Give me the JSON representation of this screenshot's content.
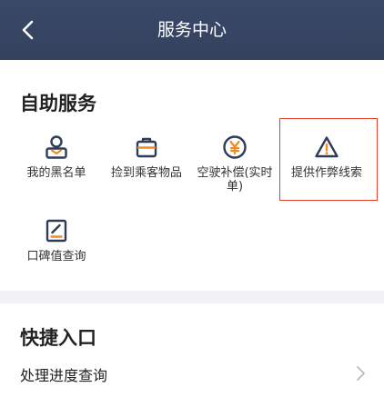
{
  "header": {
    "title": "服务中心",
    "back_icon": "chevron-left-icon"
  },
  "self_service": {
    "title": "自助服务",
    "items": [
      {
        "label": "我的黑名单",
        "icon": "user-blacklist-icon"
      },
      {
        "label": "捡到乘客物品",
        "icon": "bag-icon"
      },
      {
        "label": "空驶补偿(实时单)",
        "icon": "yen-icon"
      },
      {
        "label": "提供作弊线索",
        "icon": "warning-icon"
      },
      {
        "label": "口碑值查询",
        "icon": "edit-document-icon"
      }
    ]
  },
  "quick_entry": {
    "title": "快捷入口",
    "items": [
      {
        "label": "处理进度查询",
        "icon": "chevron-right-icon"
      }
    ]
  },
  "colors": {
    "header": "#374663",
    "icon": "#2f3c57",
    "accent": "#f28b1e",
    "highlight_border": "#e0402f"
  }
}
